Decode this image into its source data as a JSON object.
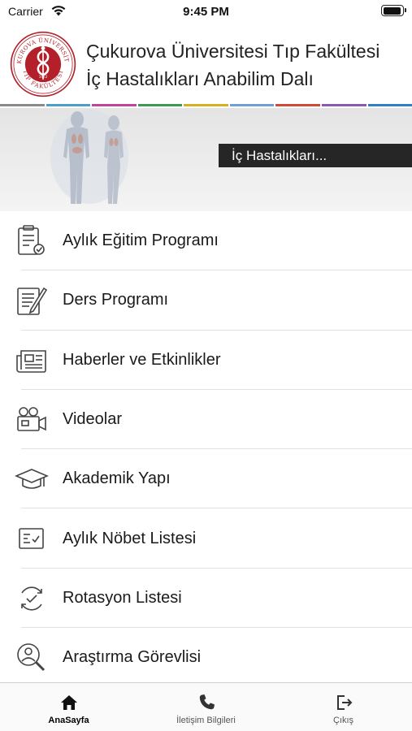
{
  "status_bar": {
    "carrier": "Carrier",
    "time": "9:45 PM",
    "battery_level": 0.92
  },
  "header": {
    "title_line1": "Çukurova Üniversitesi Tıp Fakültesi",
    "title_line2": "İç Hastalıkları Anabilim Dalı",
    "logo": {
      "top_arc": "ÇUKUROVA ÜNİVERSİTESİ",
      "bottom_arc": "TIP FAKÜLTESİ",
      "year": "1972"
    },
    "divider_colors": [
      "#8a8a8a",
      "#4aa0c8",
      "#c0449a",
      "#3c9a52",
      "#d6b022",
      "#6ea0d8",
      "#d04a38",
      "#8a5ab0",
      "#2f7ec8"
    ]
  },
  "banner": {
    "label": "İç Hastalıkları..."
  },
  "menu": {
    "items": [
      {
        "label": "Aylık Eğitim Programı",
        "icon": "clipboard-check-icon"
      },
      {
        "label": "Ders Programı",
        "icon": "document-pen-icon"
      },
      {
        "label": "Haberler ve Etkinlikler",
        "icon": "newspaper-icon"
      },
      {
        "label": "Videolar",
        "icon": "video-camera-icon"
      },
      {
        "label": "Akademik Yapı",
        "icon": "graduation-cap-icon"
      },
      {
        "label": "Aylık Nöbet Listesi",
        "icon": "checklist-icon"
      },
      {
        "label": "Rotasyon Listesi",
        "icon": "rotation-icon"
      },
      {
        "label": "Araştırma Görevlisi",
        "icon": "user-search-icon"
      }
    ]
  },
  "tab_bar": {
    "tabs": [
      {
        "label": "AnaSayfa",
        "icon": "home-icon",
        "active": true
      },
      {
        "label": "İletişim Bilgileri",
        "icon": "phone-icon",
        "active": false
      },
      {
        "label": "Çıkış",
        "icon": "logout-icon",
        "active": false
      }
    ]
  },
  "colors": {
    "logo_red": "#b3202a",
    "banner_label_bg": "#262626",
    "icon_stroke": "#444444"
  }
}
